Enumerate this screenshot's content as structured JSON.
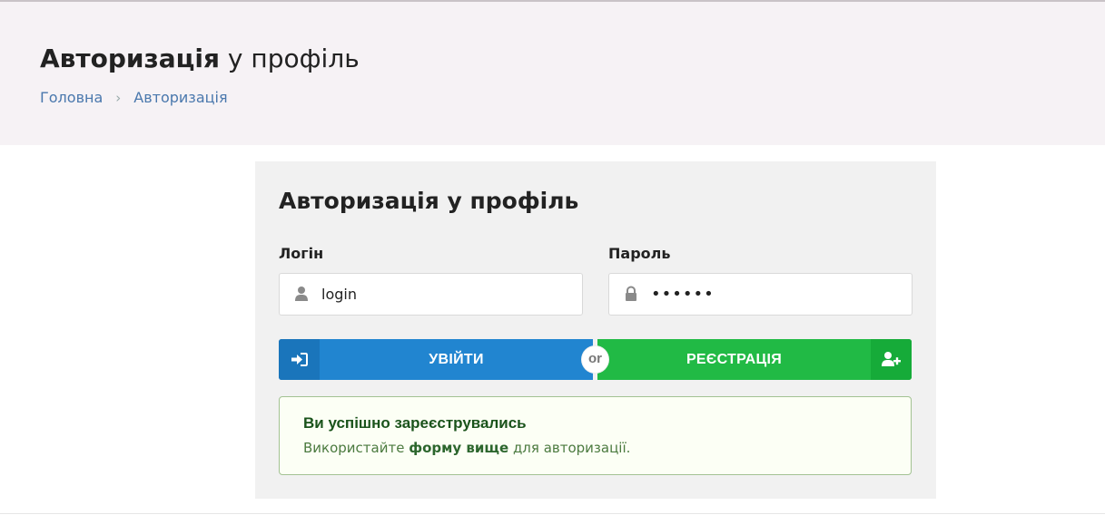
{
  "header": {
    "title_bold": "Авторизація",
    "title_rest": " у профіль",
    "breadcrumb": [
      {
        "label": "Головна"
      },
      {
        "label": "Авторизація"
      }
    ],
    "breadcrumb_separator": "›"
  },
  "form": {
    "title_bold": "Авторизація",
    "title_rest": " у профіль",
    "login_label": "Логін",
    "login_value": "login",
    "password_label": "Пароль",
    "password_value": "••••••",
    "login_button": "УВІЙТИ",
    "or_label": "or",
    "register_button": "РЕЄСТРАЦІЯ"
  },
  "message": {
    "title": "Ви успішно зареєструвались",
    "text_before": "Використайте ",
    "link": "форму вище",
    "text_after": " для авторизації."
  },
  "colors": {
    "header_bg": "#f6f2f5",
    "login_button": "#2185d0",
    "register_button": "#21ba45",
    "success_border": "#a3c293",
    "breadcrumb_link": "#4a78ad"
  },
  "icons": {
    "login_field": "user-icon",
    "password_field": "lock-icon",
    "login_button": "sign-in-icon",
    "register_button": "add-user-icon"
  }
}
